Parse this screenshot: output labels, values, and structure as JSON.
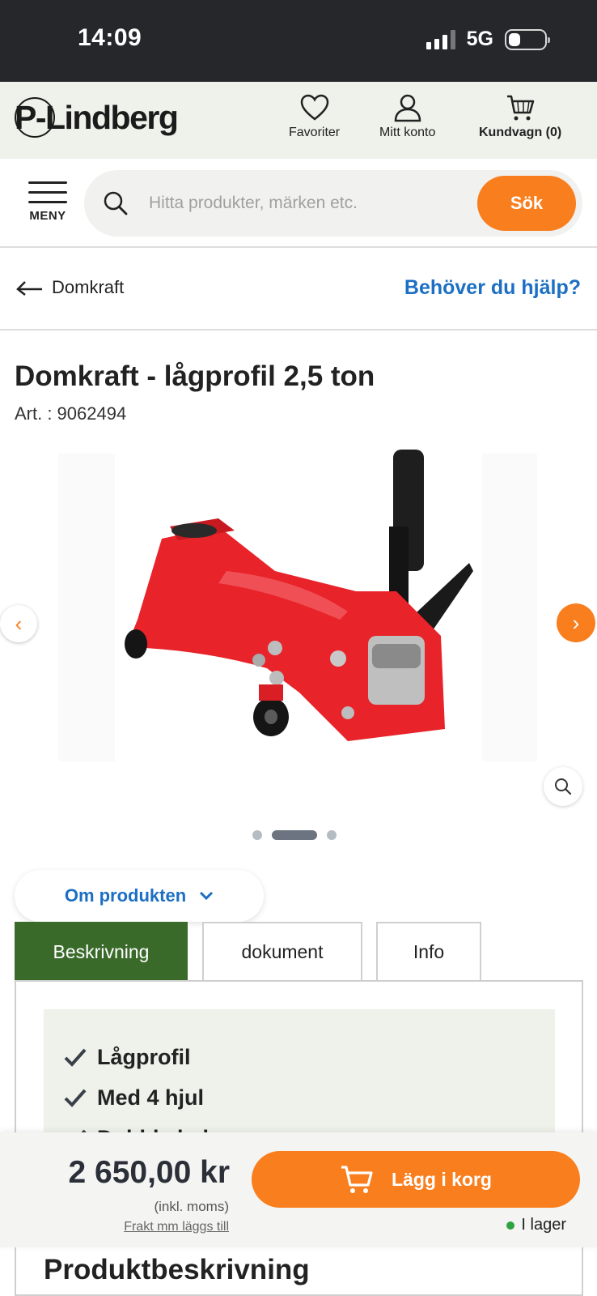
{
  "status_bar": {
    "time": "14:09",
    "network": "5G",
    "battery_icon": "battery-icon",
    "signal_icon": "signal-icon"
  },
  "header": {
    "logo": "P-Lindberg",
    "favorites_label": "Favoriter",
    "account_label": "Mitt konto",
    "cart_label": "Kundvagn (0)"
  },
  "nav": {
    "menu_label": "MENY",
    "search_placeholder": "Hitta produkter, märken etc.",
    "search_button": "Sök"
  },
  "breadcrumb": {
    "back_label": "Domkraft",
    "help_link": "Behöver du hjälp?"
  },
  "product": {
    "title": "Domkraft - lågprofil 2,5 ton",
    "article": "Art. : 9062494",
    "gallery_count": 3,
    "gallery_active_index": 2
  },
  "about": {
    "toggle_label": "Om produkten"
  },
  "tabs": [
    {
      "label": "Beskrivning",
      "active": true
    },
    {
      "label": "dokument",
      "active": false
    },
    {
      "label": "Info",
      "active": false
    }
  ],
  "features": [
    "Lågprofil",
    "Med 4 hjul",
    "Dubbla kolvar"
  ],
  "section_title": "Produktbeskrivning",
  "purchase": {
    "price": "2 650,00 kr",
    "vat_note": "(inkl. moms)",
    "freight_note": "Frakt mm läggs till",
    "add_button": "Lägg i korg",
    "stock": "I lager"
  },
  "colors": {
    "accent": "#f97e1e",
    "link": "#1c6fc4",
    "tab_active": "#3a6a2a",
    "header_bg": "#eef2ea",
    "status_bar": "#25272b",
    "in_stock": "#2fa33f"
  }
}
